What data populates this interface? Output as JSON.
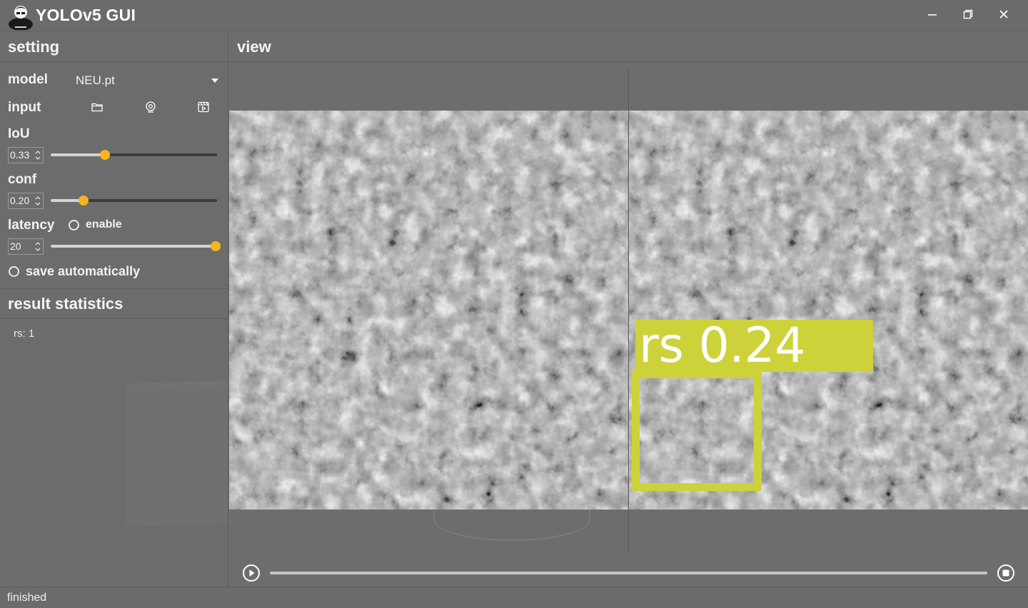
{
  "window": {
    "title": "YOLOv5 GUI",
    "controls": [
      "minimize-icon",
      "restore-icon",
      "close-icon"
    ]
  },
  "sidebar": {
    "setting_header": "setting",
    "model": {
      "label": "model",
      "value": "NEU.pt"
    },
    "input": {
      "label": "input",
      "icons": [
        "folder-icon",
        "webcam-icon",
        "video-file-icon"
      ]
    },
    "iou": {
      "label": "IoU",
      "value": "0.33",
      "slider_fraction": 0.33
    },
    "conf": {
      "label": "conf",
      "value": "0.20",
      "slider_fraction": 0.2
    },
    "latency": {
      "label": "latency",
      "enable_label": "enable",
      "enable_checked": false,
      "value": "20",
      "slider_fraction": 1.0
    },
    "save_automatically": {
      "label": "save automatically",
      "checked": false
    },
    "stats_header": "result statistics",
    "stats_text": "rs:  1"
  },
  "view": {
    "header": "view",
    "detection_label": "rs 0.24",
    "progress_fraction": 0.0
  },
  "status": {
    "text": "finished"
  },
  "colors": {
    "accent": "#f6b51f",
    "detection": "#cdd23a",
    "background": "#6e6e6e"
  }
}
